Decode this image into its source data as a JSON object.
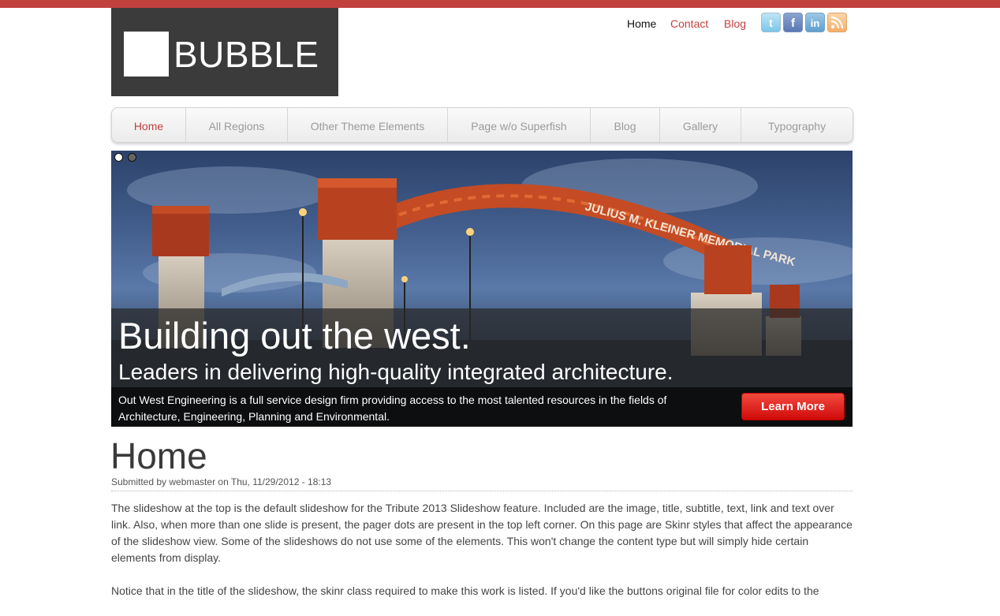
{
  "brand": {
    "logo_text": "BUBBLE",
    "accent_color": "#c1403e"
  },
  "top_links": [
    {
      "label": "Home",
      "active": true
    },
    {
      "label": "Contact",
      "active": false
    },
    {
      "label": "Blog",
      "active": false
    }
  ],
  "social": [
    "twitter-icon",
    "facebook-icon",
    "linkedin-icon",
    "rss-icon"
  ],
  "nav": [
    {
      "label": "Home",
      "active": true
    },
    {
      "label": "All Regions",
      "active": false
    },
    {
      "label": "Other Theme Elements",
      "active": false
    },
    {
      "label": "Page w/o Superfish",
      "active": false
    },
    {
      "label": "Blog",
      "active": false
    },
    {
      "label": "Gallery",
      "active": false
    },
    {
      "label": "Typography",
      "active": false
    }
  ],
  "slideshow": {
    "slide_count": 2,
    "active_slide": 1,
    "sign_text": "JULIUS M. KLEINER MEMORIAL PARK",
    "title": "Building out the west.",
    "subtitle": "Leaders in delivering high-quality integrated architecture.",
    "text": "Out West Engineering is a full service design firm providing access to the most talented resources in the fields of Architecture, Engineering, Planning and Environmental.",
    "button_label": "Learn More"
  },
  "content": {
    "title": "Home",
    "submitted": "Submitted by webmaster on Thu, 11/29/2012 - 18:13",
    "paragraphs": [
      "The slideshow at the top is the default slideshow for the Tribute 2013 Slideshow feature. Included are the image, title, subtitle, text, link and text over link. Also, when more than one slide is present, the pager dots are present in the top left corner. On this page are Skinr styles that affect the appearance of the slideshow view. Some of the slideshows do not use some of the elements. This won't change the content type but will simply hide certain elements from display.",
      "Notice that in the title of the slideshow, the skinr class required to make this work is listed. If you'd like the buttons original file for color edits to the"
    ]
  }
}
